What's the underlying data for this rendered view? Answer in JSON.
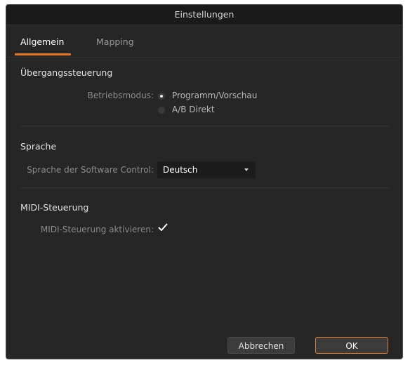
{
  "window": {
    "title": "Einstellungen"
  },
  "tabs": [
    {
      "label": "Allgemein",
      "active": true
    },
    {
      "label": "Mapping",
      "active": false
    }
  ],
  "transition": {
    "title": "Übergangssteuerung",
    "mode_label": "Betriebsmodus:",
    "options": [
      {
        "label": "Programm/Vorschau",
        "selected": true
      },
      {
        "label": "A/B Direkt",
        "selected": false
      }
    ]
  },
  "language": {
    "title": "Sprache",
    "label": "Sprache der Software Control:",
    "selected": "Deutsch"
  },
  "midi": {
    "title": "MIDI-Steuerung",
    "enable_label": "MIDI-Steuerung aktivieren:",
    "enabled": true
  },
  "buttons": {
    "cancel": "Abbrechen",
    "ok": "OK"
  },
  "colors": {
    "accent": "#e87722",
    "background": "#262626"
  }
}
